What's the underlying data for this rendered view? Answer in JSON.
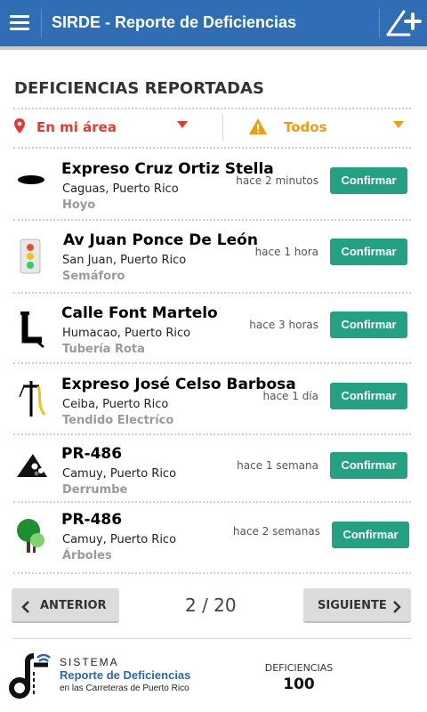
{
  "app": {
    "title": "SIRDE - Reporte de Deficiencias",
    "menu_icon": "hamburger-menu-icon",
    "add_icon": "add-report-icon",
    "colors": {
      "appbar": "#2f6db4",
      "accent_red": "#e8382f",
      "accent_orange": "#f39c12",
      "confirm_green": "#22a183"
    }
  },
  "section": {
    "title": "DEFICIENCIAS REPORTADAS"
  },
  "filters": {
    "area": {
      "label": "En mi área",
      "icon": "location-pin-icon"
    },
    "type": {
      "label": "Todos",
      "icon": "warning-icon"
    }
  },
  "reports": [
    {
      "title": "Expreso Cruz Ortiz Stella",
      "location": "Caguas, Puerto Rico",
      "category": "Hoyo",
      "time": "hace 2 minutos",
      "action": "Confirmar",
      "icon": "pothole-icon"
    },
    {
      "title": "Av Juan Ponce De León",
      "location": "San Juan, Puerto Rico",
      "category": "Semáforo",
      "time": "hace 1 hora",
      "action": "Confirmar",
      "icon": "traffic-light-icon"
    },
    {
      "title": "Calle Font Martelo",
      "location": "Humacao, Puerto Rico",
      "category": "Tubería Rota",
      "time": "hace 3 horas",
      "action": "Confirmar",
      "icon": "broken-pipe-icon"
    },
    {
      "title": "Expreso José Celso Barbosa",
      "location": "Ceiba, Puerto Rico",
      "category": "Tendido Electríco",
      "time": "hace 1 día",
      "action": "Confirmar",
      "icon": "power-line-icon"
    },
    {
      "title": "PR-486",
      "location": "Camuy, Puerto Rico",
      "category": "Derrumbe",
      "time": "hace 1 semana",
      "action": "Confirmar",
      "icon": "landslide-icon"
    },
    {
      "title": "PR-486",
      "location": "Camuy, Puerto Rico",
      "category": "Árboles",
      "time": "hace 2 semanas",
      "action": "Confirmar",
      "icon": "tree-icon"
    }
  ],
  "pagination": {
    "prev_label": "ANTERIOR",
    "next_label": "SIGUIENTE",
    "current": "2 / 20"
  },
  "footer": {
    "logo_line1": "SISTEMA",
    "logo_line2": "Reporte de Deficiencias",
    "logo_line3": "en las Carreteras de Puerto Rico",
    "count_label": "DEFICIENCIAS",
    "count_value": "100"
  }
}
